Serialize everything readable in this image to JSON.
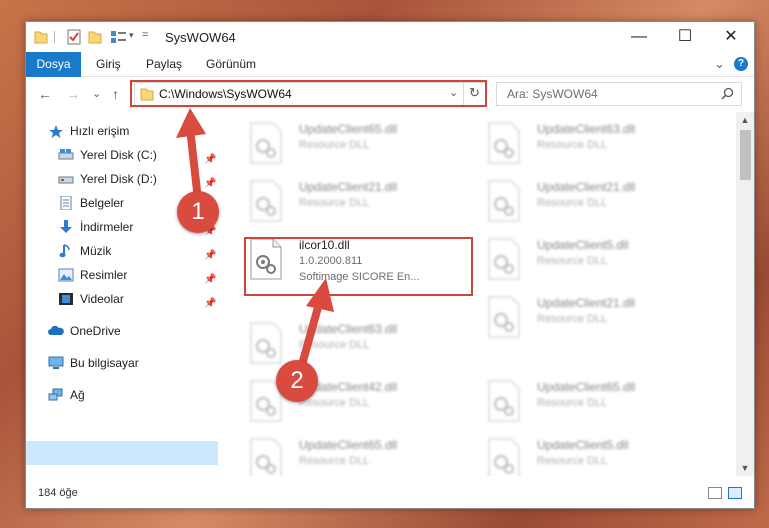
{
  "window": {
    "title": "SysWOW64",
    "minimize": "—",
    "maximize": "☐",
    "close": "✕"
  },
  "ribbon": {
    "tabs": [
      "Dosya",
      "Giriş",
      "Paylaş",
      "Görünüm"
    ],
    "expand": "⌄",
    "help": "?"
  },
  "address": {
    "path": "C:\\Windows\\SysWOW64",
    "search_placeholder": "Ara: SysWOW64"
  },
  "nav": {
    "back": "←",
    "forward": "→",
    "recent": "⌄",
    "up": "↑",
    "dropdown": "⌄",
    "refresh": "↻",
    "search_glyph": "⚲"
  },
  "sidebar": {
    "quick_access": "Hızlı erişim",
    "items": [
      {
        "label": "Yerel Disk (C:)",
        "icon": "drive-icon",
        "pinned": true
      },
      {
        "label": "Yerel Disk (D:)",
        "icon": "drive-icon",
        "pinned": true
      },
      {
        "label": "Belgeler",
        "icon": "documents-icon",
        "pinned": true
      },
      {
        "label": "İndirmeler",
        "icon": "download-icon",
        "pinned": true
      },
      {
        "label": "Müzik",
        "icon": "music-icon",
        "pinned": true
      },
      {
        "label": "Resimler",
        "icon": "pictures-icon",
        "pinned": true
      },
      {
        "label": "Videolar",
        "icon": "video-icon",
        "pinned": true
      }
    ],
    "onedrive": "OneDrive",
    "this_pc": "Bu bilgisayar",
    "network": "Ağ",
    "pin_glyph": "📌"
  },
  "files": {
    "highlighted": {
      "name": "ilcor10.dll",
      "version": "1.0.2000.811",
      "company": "Softimage SICORE En..."
    },
    "left_column": [
      {
        "name": "UpdateClient65.dll",
        "desc": "Resource DLL"
      },
      {
        "name": "UpdateClient21.dll",
        "desc": "Resource DLL"
      },
      {
        "name": "UpdateClient63.dll",
        "desc": "Resource DLL"
      },
      {
        "name": "UpdateClient42.dll",
        "desc": "Resource DLL"
      },
      {
        "name": "UpdateClient65.dll",
        "desc": "Resource DLL"
      }
    ],
    "right_column": [
      {
        "name": "UpdateClient63.dll",
        "desc": "Resource DLL"
      },
      {
        "name": "UpdateClient21.dll",
        "desc": "Resource DLL"
      },
      {
        "name": "UpdateClient5.dll",
        "desc": "Resource DLL"
      },
      {
        "name": "UpdateClient21.dll",
        "desc": "Resource DLL"
      },
      {
        "name": "UpdateClient65.dll",
        "desc": "Resource DLL"
      },
      {
        "name": "UpdateClient5.dll",
        "desc": "Resource DLL"
      }
    ]
  },
  "status": {
    "count": "184 öğe"
  },
  "callouts": {
    "one": "1",
    "two": "2"
  },
  "colors": {
    "accent": "#1979ca",
    "highlight": "#d0453a",
    "selection": "#cce8ff"
  }
}
